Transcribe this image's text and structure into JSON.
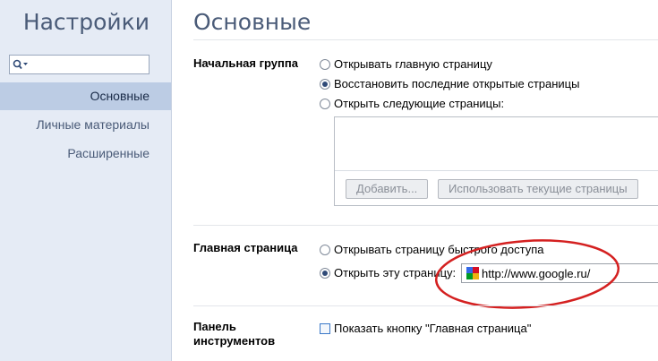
{
  "sidebar": {
    "title": "Настройки",
    "search": {
      "placeholder": "",
      "value": ""
    },
    "items": [
      {
        "label": "Основные",
        "active": true
      },
      {
        "label": "Личные материалы",
        "active": false
      },
      {
        "label": "Расширенные",
        "active": false
      }
    ]
  },
  "main": {
    "title": "Основные",
    "startup": {
      "label": "Начальная группа",
      "options": [
        {
          "label": "Открывать главную страницу",
          "checked": false
        },
        {
          "label": "Восстановить последние открытые страницы",
          "checked": true
        },
        {
          "label": "Открыть следующие страницы:",
          "checked": false
        }
      ],
      "add_button": "Добавить...",
      "use_current_button": "Использовать текущие страницы"
    },
    "homepage": {
      "label": "Главная страница",
      "options": [
        {
          "label": "Открывать страницу быстрого доступа",
          "checked": false
        },
        {
          "label": "Открыть эту страницу:",
          "checked": true
        }
      ],
      "url": "http://www.google.ru/"
    },
    "toolbar": {
      "label_line1": "Панель",
      "label_line2": "инструментов",
      "checkbox_label": "Показать кнопку \"Главная страница\"",
      "checked": false
    }
  },
  "colors": {
    "sidebar_bg": "#e5ebf5",
    "active_item_bg": "#bccce4",
    "title_color": "#4a5b78",
    "annotation_red": "#d42020"
  }
}
